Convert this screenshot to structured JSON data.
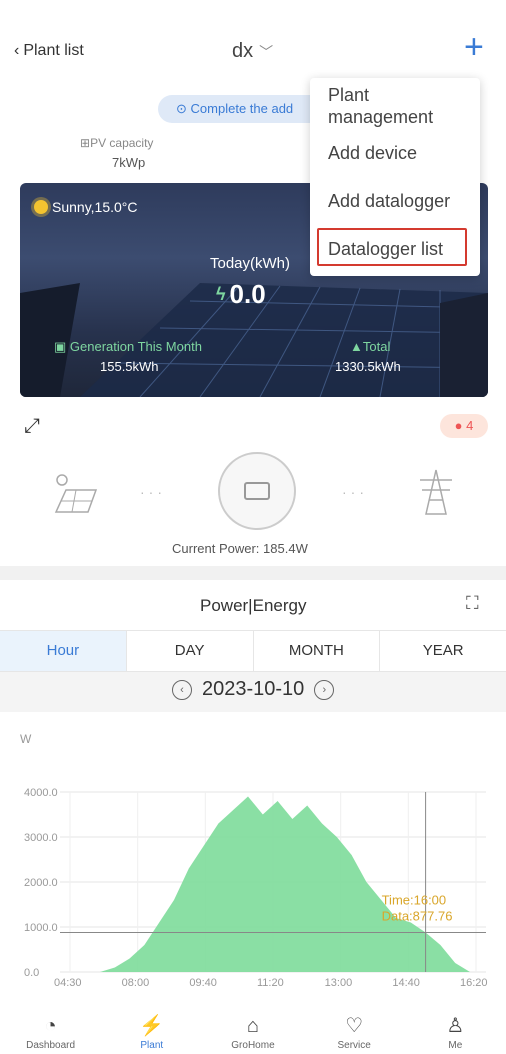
{
  "header": {
    "back_label": "Plant list",
    "plant_name": "dx",
    "add_icon": "plus-icon"
  },
  "notice": {
    "text": "Complete the add"
  },
  "pv": {
    "label": "PV capacity",
    "value": "7kWp"
  },
  "banner": {
    "weather": "Sunny,15.0°C",
    "today_label": "Today(kWh)",
    "today_value": "0.0",
    "gen_label": "Generation This Month",
    "gen_value": "155.5kWh",
    "total_label": "Total",
    "total_value": "1330.5kWh"
  },
  "menu": {
    "items": [
      {
        "label": "Plant management"
      },
      {
        "label": "Add device"
      },
      {
        "label": "Add datalogger"
      },
      {
        "label": "Datalogger list"
      }
    ],
    "highlight_color": "#d43a2f"
  },
  "alert": {
    "count": "4"
  },
  "power": {
    "current": "Current Power: 185.4W"
  },
  "energy": {
    "title": "Power|Energy",
    "tabs": [
      "Hour",
      "DAY",
      "MONTH",
      "YEAR"
    ],
    "active_tab": "Hour",
    "date": "2023-10-10",
    "unit": "W"
  },
  "chart_data": {
    "type": "area",
    "ylim": [
      0,
      4000
    ],
    "yticks": [
      "4000.0",
      "3000.0",
      "2000.0",
      "1000.0",
      "0.0"
    ],
    "xticks": [
      "04:30",
      "08:00",
      "09:40",
      "11:20",
      "13:00",
      "14:40",
      "16:20"
    ],
    "x": [
      "07:00",
      "07:30",
      "08:00",
      "08:30",
      "09:00",
      "09:30",
      "10:00",
      "10:30",
      "11:00",
      "11:15",
      "11:30",
      "11:45",
      "12:00",
      "12:15",
      "12:30",
      "12:45",
      "13:00",
      "13:30",
      "14:00",
      "14:30",
      "15:00",
      "15:30",
      "16:00",
      "16:30",
      "17:00",
      "17:20"
    ],
    "values": [
      0,
      100,
      300,
      600,
      1100,
      1600,
      2300,
      2800,
      3300,
      3600,
      3900,
      3500,
      3800,
      3400,
      3700,
      3300,
      3000,
      2600,
      2000,
      1600,
      1200,
      1100,
      877.76,
      600,
      200,
      0
    ],
    "tooltip": {
      "time": "Time:16:00",
      "data": "Data:877.76"
    },
    "color": "#7ddb9a"
  },
  "bottom_nav": [
    {
      "label": "Dashboard",
      "icon": "dashboard-icon"
    },
    {
      "label": "Plant",
      "icon": "plant-icon"
    },
    {
      "label": "GroHome",
      "icon": "home-icon"
    },
    {
      "label": "Service",
      "icon": "service-icon"
    },
    {
      "label": "Me",
      "icon": "user-icon"
    }
  ]
}
